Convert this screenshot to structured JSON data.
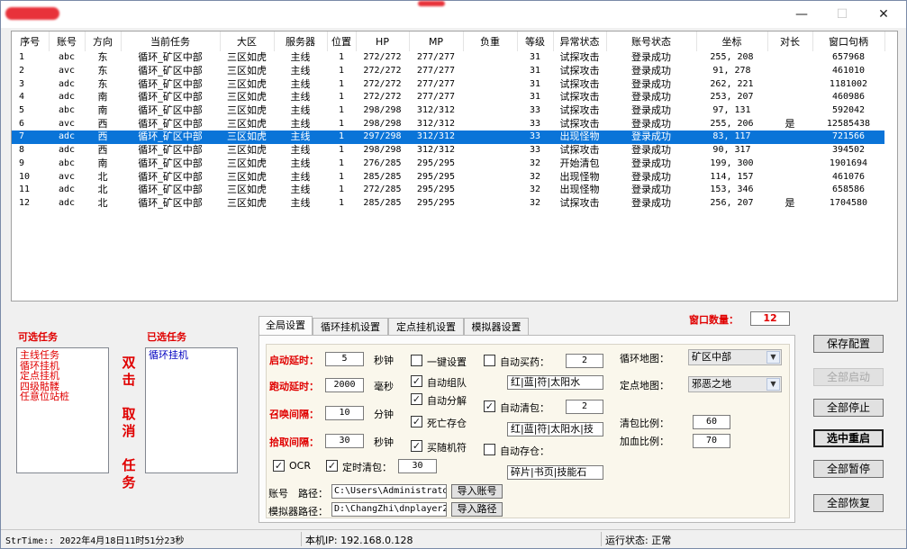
{
  "window": {
    "controls": {
      "minimize": "—",
      "maximize": "☐",
      "close": "✕"
    }
  },
  "table": {
    "columns": [
      "序号",
      "账号",
      "方向",
      "当前任务",
      "大区",
      "服务器",
      "位置",
      "HP",
      "MP",
      "负重",
      "等级",
      "异常状态",
      "账号状态",
      "坐标",
      "对长",
      "窗口句柄"
    ],
    "rows": [
      [
        "1",
        "abc",
        "东",
        "循环_矿区中部",
        "三区如虎",
        "主线",
        "1",
        "272/272",
        "277/277",
        "",
        "31",
        "试探攻击",
        "登录成功",
        "255, 208",
        "",
        "657968"
      ],
      [
        "2",
        "avc",
        "东",
        "循环_矿区中部",
        "三区如虎",
        "主线",
        "1",
        "272/272",
        "277/277",
        "",
        "31",
        "试探攻击",
        "登录成功",
        "91, 278",
        "",
        "461010"
      ],
      [
        "3",
        "adc",
        "东",
        "循环_矿区中部",
        "三区如虎",
        "主线",
        "1",
        "272/272",
        "277/277",
        "",
        "31",
        "试探攻击",
        "登录成功",
        "262, 221",
        "",
        "1181002"
      ],
      [
        "4",
        "adc",
        "南",
        "循环_矿区中部",
        "三区如虎",
        "主线",
        "1",
        "272/272",
        "277/277",
        "",
        "31",
        "试探攻击",
        "登录成功",
        "253, 207",
        "",
        "460986"
      ],
      [
        "5",
        "abc",
        "南",
        "循环_矿区中部",
        "三区如虎",
        "主线",
        "1",
        "298/298",
        "312/312",
        "",
        "33",
        "试探攻击",
        "登录成功",
        "97, 131",
        "",
        "592042"
      ],
      [
        "6",
        "avc",
        "西",
        "循环_矿区中部",
        "三区如虎",
        "主线",
        "1",
        "298/298",
        "312/312",
        "",
        "33",
        "试探攻击",
        "登录成功",
        "255, 206",
        "是",
        "12585438"
      ],
      [
        "7",
        "adc",
        "西",
        "循环_矿区中部",
        "三区如虎",
        "主线",
        "1",
        "297/298",
        "312/312",
        "",
        "33",
        "出现怪物",
        "登录成功",
        "83, 117",
        "",
        "721566"
      ],
      [
        "8",
        "adc",
        "西",
        "循环_矿区中部",
        "三区如虎",
        "主线",
        "1",
        "298/298",
        "312/312",
        "",
        "33",
        "试探攻击",
        "登录成功",
        "90, 317",
        "",
        "394502"
      ],
      [
        "9",
        "abc",
        "南",
        "循环_矿区中部",
        "三区如虎",
        "主线",
        "1",
        "276/285",
        "295/295",
        "",
        "32",
        "开始清包",
        "登录成功",
        "199, 300",
        "",
        "1901694"
      ],
      [
        "10",
        "avc",
        "北",
        "循环_矿区中部",
        "三区如虎",
        "主线",
        "1",
        "285/285",
        "295/295",
        "",
        "32",
        "出现怪物",
        "登录成功",
        "114, 157",
        "",
        "461076"
      ],
      [
        "11",
        "adc",
        "北",
        "循环_矿区中部",
        "三区如虎",
        "主线",
        "1",
        "272/285",
        "295/295",
        "",
        "32",
        "出现怪物",
        "登录成功",
        "153, 346",
        "",
        "658586"
      ],
      [
        "12",
        "adc",
        "北",
        "循环_矿区中部",
        "三区如虎",
        "主线",
        "1",
        "285/285",
        "295/295",
        "",
        "32",
        "试探攻击",
        "登录成功",
        "256, 207",
        "是",
        "1704580"
      ]
    ],
    "selected_row": 6
  },
  "tasks": {
    "available_label": "可选任务",
    "available": [
      "主线任务",
      "循环挂机",
      "定点挂机",
      "四级骷髅",
      "任意位站桩"
    ],
    "selected_label": "已选任务",
    "selected": [
      "循环挂机"
    ],
    "hint_chars": [
      "双",
      "击",
      "",
      "取",
      "消",
      "",
      "任",
      "务"
    ]
  },
  "tabs": [
    "全局设置",
    "循环挂机设置",
    "定点挂机设置",
    "模拟器设置"
  ],
  "active_tab": 0,
  "window_count": {
    "label": "窗口数量：",
    "value": "12"
  },
  "settings": {
    "start_delay": {
      "label": "启动延时：",
      "value": "5",
      "unit": "秒钟"
    },
    "run_delay": {
      "label": "跑动延时：",
      "value": "2000",
      "unit": "毫秒"
    },
    "summon_interval": {
      "label": "召唤间隔：",
      "value": "10",
      "unit": "分钟"
    },
    "pickup_interval": {
      "label": "拾取间隔：",
      "value": "30",
      "unit": "秒钟"
    },
    "ocr": {
      "label": "OCR",
      "checked": true
    },
    "timed_clean": {
      "label": "定时清包：",
      "checked": true,
      "value": "30"
    },
    "one_key": {
      "label": "一键设置",
      "checked": false
    },
    "auto_team": {
      "label": "自动组队",
      "checked": true
    },
    "auto_decompose": {
      "label": "自动分解",
      "checked": true
    },
    "death_save": {
      "label": "死亡存仓",
      "checked": true
    },
    "buy_charm": {
      "label": "买随机符",
      "checked": true
    },
    "auto_buy_potion": {
      "label": "自动买药：",
      "checked": false,
      "value": "2",
      "items": "红|蓝|符|太阳水"
    },
    "auto_clean": {
      "label": "自动清包：",
      "checked": true,
      "value": "2",
      "items": "红|蓝|符|太阳水|技"
    },
    "auto_store": {
      "label": "自动存仓：",
      "checked": false,
      "items": "碎片|书页|技能石"
    },
    "loop_map": {
      "label": "循环地图：",
      "value": "矿区中部"
    },
    "fixed_map": {
      "label": "定点地图：",
      "value": "邪恶之地"
    },
    "clean_ratio": {
      "label": "清包比例：",
      "value": "60"
    },
    "hp_ratio": {
      "label": "加血比例：",
      "value": "70"
    },
    "account_path": {
      "label1": "账号",
      "label2": "路径：",
      "value": "C:\\Users\\Administrato",
      "button": "导入账号"
    },
    "emulator_path": {
      "label": "模拟器路径：",
      "value": "D:\\ChangZhi\\dnplayer2",
      "button": "导入路径"
    }
  },
  "buttons": {
    "save": "保存配置",
    "start_all": "全部启动",
    "stop_all": "全部停止",
    "restart_selected": "选中重启",
    "pause_all": "全部暂停",
    "resume_all": "全部恢复"
  },
  "status": {
    "time": "StrTime:: 2022年4月18日11时51分23秒",
    "ip": "本机IP: 192.168.0.128",
    "state": "运行状态: 正常"
  }
}
